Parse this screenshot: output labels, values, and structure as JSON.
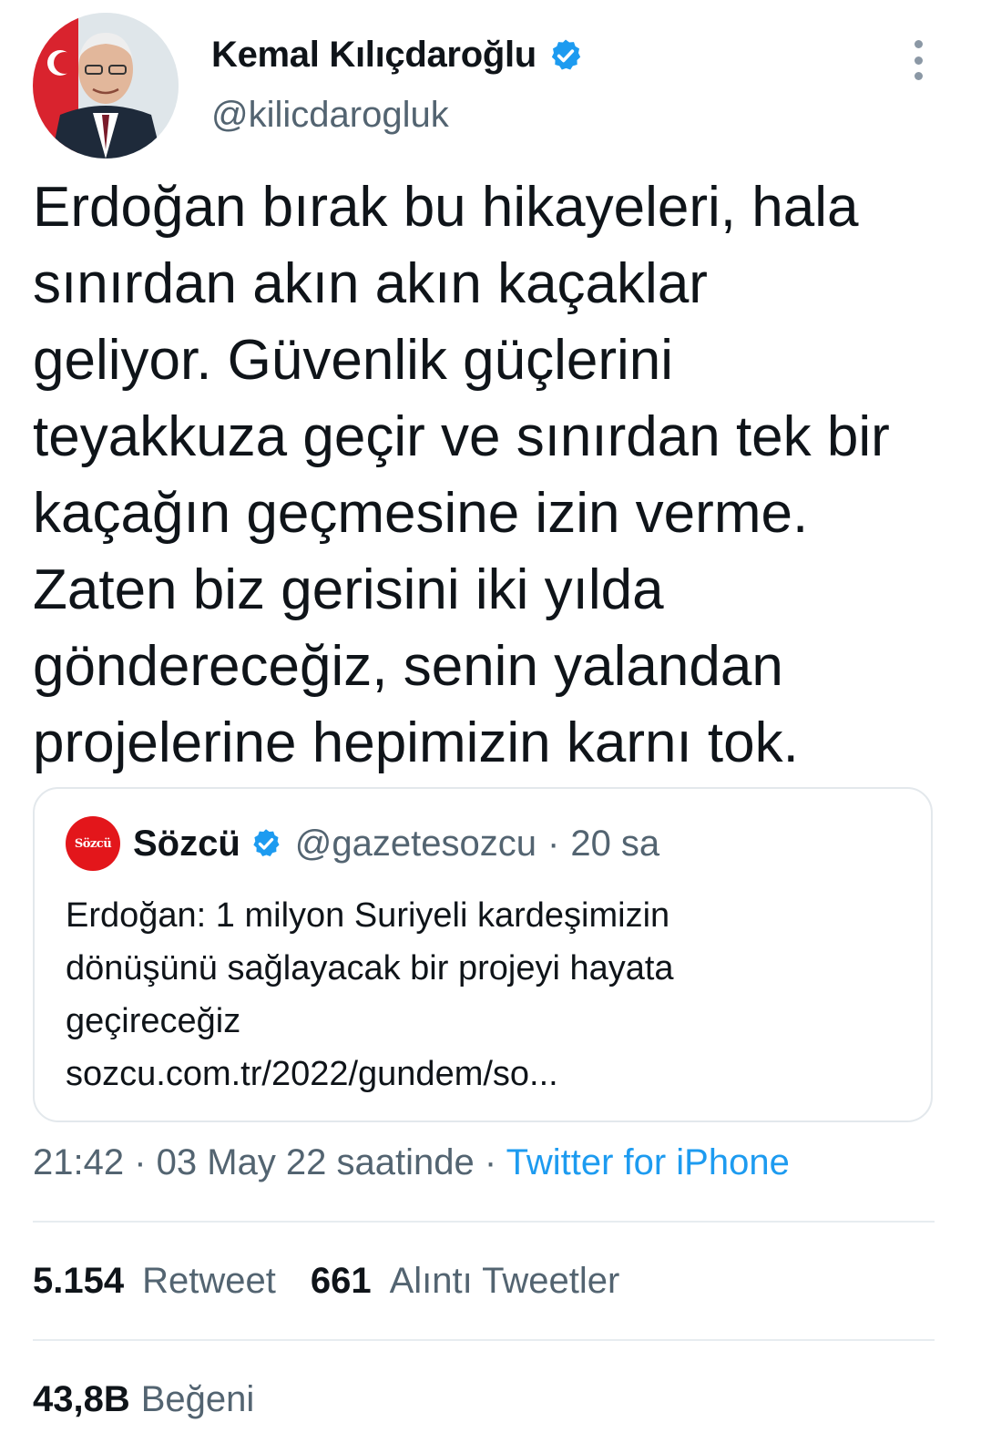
{
  "author": {
    "name": "Kemal Kılıçdaroğlu",
    "handle": "@kilicdarogluk",
    "verified_color": "#1d9bf0"
  },
  "tweet": {
    "lines": [
      "Erdoğan bırak bu hikayeleri, hala",
      "sınırdan akın akın kaçaklar",
      "geliyor. Güvenlik güçlerini",
      "teyakkuza geçir ve sınırdan tek bir",
      "kaçağın geçmesine izin verme.",
      "Zaten biz gerisini iki yılda",
      "göndereceğiz, senin yalandan",
      "projelerine hepimizin karnı tok."
    ]
  },
  "quote": {
    "logo_text": "Sözcü",
    "name": "Sözcü",
    "handle": "@gazetesozcu",
    "separator": "·",
    "time": "20 sa",
    "lines": [
      "Erdoğan: 1 milyon Suriyeli kardeşimizin",
      "dönüşünü sağlayacak bir projeyi hayata",
      "geçireceğiz",
      "sozcu.com.tr/2022/gundem/so..."
    ],
    "logo_color": "#e3161b"
  },
  "meta": {
    "time_date": "21:42 · 03 May 22 saatinde · ",
    "source": "Twitter for iPhone",
    "accent": "#1d9bf0"
  },
  "stats": {
    "retweets_count": "5.154",
    "retweets_label": "Retweet",
    "quotes_count": "661",
    "quotes_label": "Alıntı Tweetler",
    "likes_count": "43,8B",
    "likes_label": "Beğeni"
  },
  "icons": {
    "verified": "verified-badge-icon",
    "more": "more-options-icon"
  }
}
